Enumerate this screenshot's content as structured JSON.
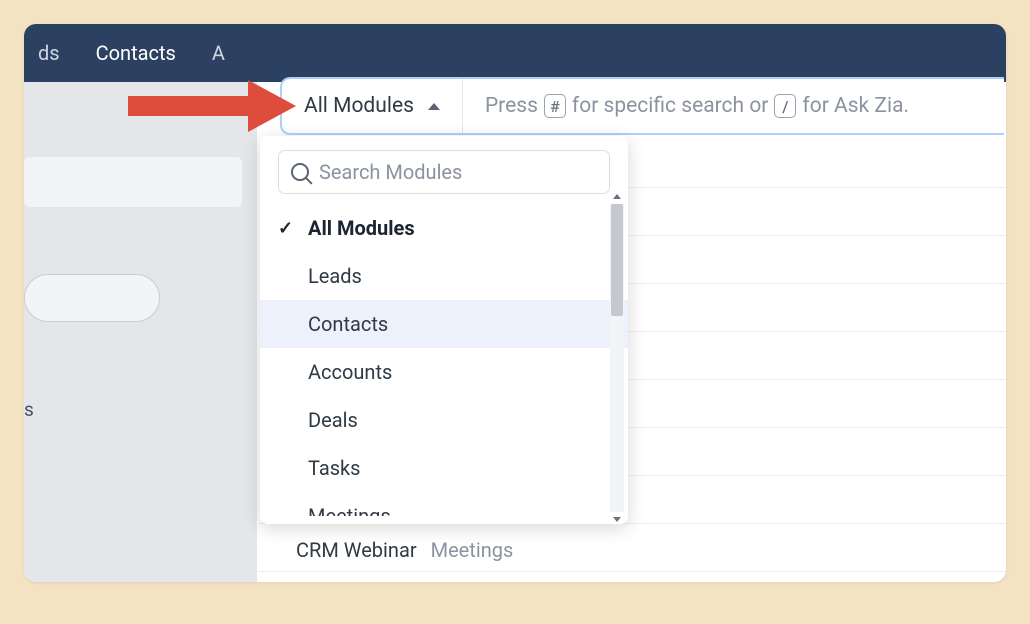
{
  "nav": {
    "items": [
      {
        "label": "ds"
      },
      {
        "label": "Contacts"
      },
      {
        "label": "A"
      }
    ]
  },
  "leftPanel": {
    "partialText": "s"
  },
  "search": {
    "moduleLabel": "All Modules",
    "hintPrefix": "Press",
    "hintKey1": "#",
    "hintMid": "for specific search or",
    "hintKey2": "/",
    "hintSuffix": "for Ask Zia."
  },
  "dropdown": {
    "searchPlaceholder": "Search Modules",
    "items": [
      {
        "label": "All Modules",
        "selected": true,
        "hovered": false
      },
      {
        "label": "Leads",
        "selected": false,
        "hovered": false
      },
      {
        "label": "Contacts",
        "selected": false,
        "hovered": true
      },
      {
        "label": "Accounts",
        "selected": false,
        "hovered": false
      },
      {
        "label": "Deals",
        "selected": false,
        "hovered": false
      },
      {
        "label": "Tasks",
        "selected": false,
        "hovered": false
      },
      {
        "label": "Meetings",
        "selected": false,
        "hovered": false
      }
    ]
  },
  "result": {
    "title": "CRM Webinar",
    "module": "Meetings"
  }
}
